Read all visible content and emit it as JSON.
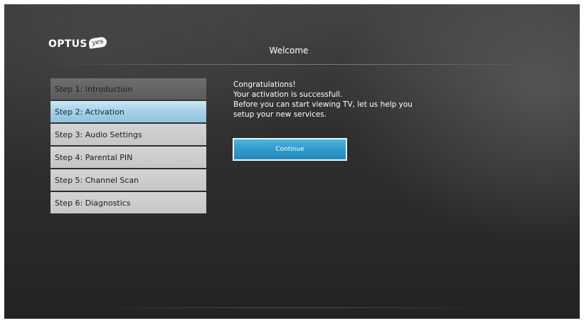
{
  "brand": {
    "name": "OPTUS",
    "badge": "yes"
  },
  "header": {
    "title": "Welcome"
  },
  "steps": [
    {
      "label": "Step 1: Introduction",
      "state": "done"
    },
    {
      "label": "Step 2: Activation",
      "state": "active"
    },
    {
      "label": "Step 3: Audio Settings",
      "state": "pending"
    },
    {
      "label": "Step 4: Parental PIN",
      "state": "pending"
    },
    {
      "label": "Step 5: Channel Scan",
      "state": "pending"
    },
    {
      "label": "Step 6: Diagnostics",
      "state": "pending"
    }
  ],
  "message": {
    "lines": [
      "Congratulations!",
      "Your activation is successfull.",
      "Before you can start viewing TV, let us help you",
      "setup your new services."
    ]
  },
  "continue_button": {
    "label": "Continue"
  },
  "colors": {
    "background": "#2f2f2f",
    "step_inactive": "#c9c9c9",
    "step_done": "#636363",
    "step_active": "#a8d2e8",
    "button": "#2f9acb"
  }
}
